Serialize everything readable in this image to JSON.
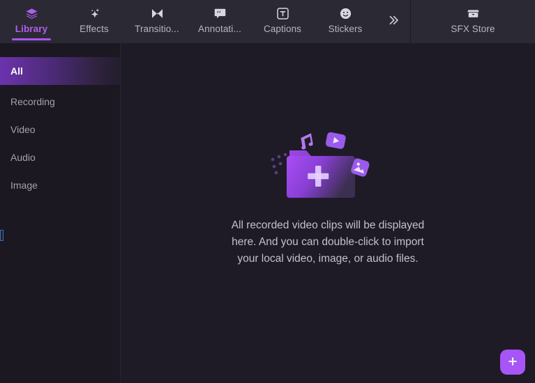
{
  "toolbar": {
    "tabs": [
      {
        "label": "Library",
        "icon": "layers-icon",
        "active": true
      },
      {
        "label": "Effects",
        "icon": "sparkle-icon",
        "active": false
      },
      {
        "label": "Transitio...",
        "icon": "transition-icon",
        "active": false
      },
      {
        "label": "Annotati...",
        "icon": "speech-bubble-icon",
        "active": false
      },
      {
        "label": "Captions",
        "icon": "text-box-icon",
        "active": false
      },
      {
        "label": "Stickers",
        "icon": "smiley-icon",
        "active": false
      }
    ],
    "overflow": {
      "label": "»",
      "icon": "chevron-double-right-icon"
    },
    "store": {
      "label": "SFX Store",
      "icon": "store-icon"
    }
  },
  "sidebar": {
    "items": [
      {
        "label": "All",
        "active": true
      },
      {
        "label": "Recording",
        "active": false
      },
      {
        "label": "Video",
        "active": false
      },
      {
        "label": "Audio",
        "active": false
      },
      {
        "label": "Image",
        "active": false
      }
    ]
  },
  "main": {
    "empty_state": {
      "illustration": "folder-with-media-icons",
      "message": "All recorded video clips will be displayed here. And you can double-click to import your local video, image, or audio files."
    },
    "add_button": {
      "label": "+",
      "icon": "plus-icon"
    }
  },
  "colors": {
    "accent": "#a855f7",
    "toolbar_bg": "#2b2933",
    "content_bg": "#1e1b26",
    "sidebar_bg": "#1b1822",
    "text_muted": "#a4a1ae"
  }
}
